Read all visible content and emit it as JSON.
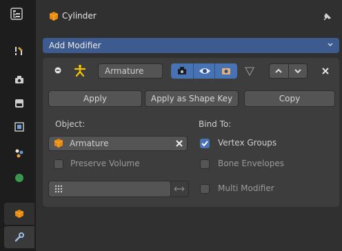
{
  "header": {
    "title": "Cylinder"
  },
  "add_modifier": {
    "label": "Add Modifier"
  },
  "modifier": {
    "name": "Armature",
    "apply_label": "Apply",
    "apply_shape_key_label": "Apply as Shape Key",
    "copy_label": "Copy",
    "object_label": "Object:",
    "object_value": "Armature",
    "bind_to_label": "Bind To:",
    "vertex_groups_label": "Vertex Groups",
    "vertex_groups_checked": true,
    "preserve_volume_label": "Preserve Volume",
    "preserve_volume_checked": false,
    "bone_envelopes_label": "Bone Envelopes",
    "bone_envelopes_checked": false,
    "multi_modifier_label": "Multi Modifier",
    "multi_modifier_checked": false,
    "vertex_group_value": ""
  },
  "tabs": [
    "tool",
    "render",
    "output",
    "view-layer",
    "scene",
    "world",
    "object",
    "modifiers"
  ],
  "colors": {
    "accent": "#4772b3",
    "add_modifier_bg": "#3d5b8f",
    "object_orange": "#e8890c",
    "armature_yellow": "#f5c400",
    "world_green": "#3a9b45"
  }
}
